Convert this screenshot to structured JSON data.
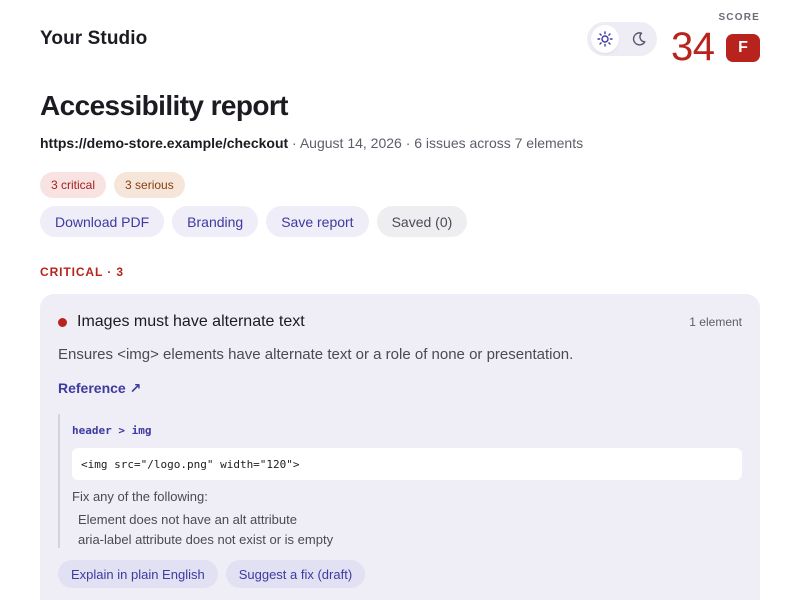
{
  "header": {
    "studio_name": "Your Studio",
    "theme_toggle": {
      "options": [
        "light",
        "dark"
      ],
      "selected": "light"
    },
    "score": {
      "label": "SCORE",
      "value": "34",
      "grade": "F"
    }
  },
  "report": {
    "title": "Accessibility report",
    "url": "https://demo-store.example/checkout",
    "meta": " · August 14, 2026 · 6 issues across 7 elements",
    "pills": [
      {
        "label": "3 critical",
        "severity": "critical"
      },
      {
        "label": "3 serious",
        "severity": "serious"
      }
    ],
    "actions": [
      {
        "label": "Download PDF"
      },
      {
        "label": "Branding"
      },
      {
        "label": "Save report"
      },
      {
        "label": "Saved (0)"
      }
    ]
  },
  "section": {
    "heading": "CRITICAL · 3"
  },
  "issue": {
    "title": "Images must have alternate text",
    "count": "1 element",
    "description": "Ensures <img> elements have alternate text or a role of none or presentation.",
    "reference": "Reference ↗",
    "node": {
      "selector": "header > img",
      "html": "<img src=\"/logo.png\" width=\"120\">",
      "fix_heading": "Fix any of the following:",
      "fixes": [
        "Element does not have an alt attribute",
        "aria-label attribute does not exist or is empty"
      ]
    },
    "actions": [
      {
        "label": "Explain in plain English"
      },
      {
        "label": "Suggest a fix (draft)"
      }
    ]
  },
  "colors": {
    "critical": "#b8231d",
    "accent": "#3d3aa0",
    "card_bg": "#efedf5"
  },
  "icons": {
    "light": "sun-icon",
    "dark": "moon-icon"
  }
}
